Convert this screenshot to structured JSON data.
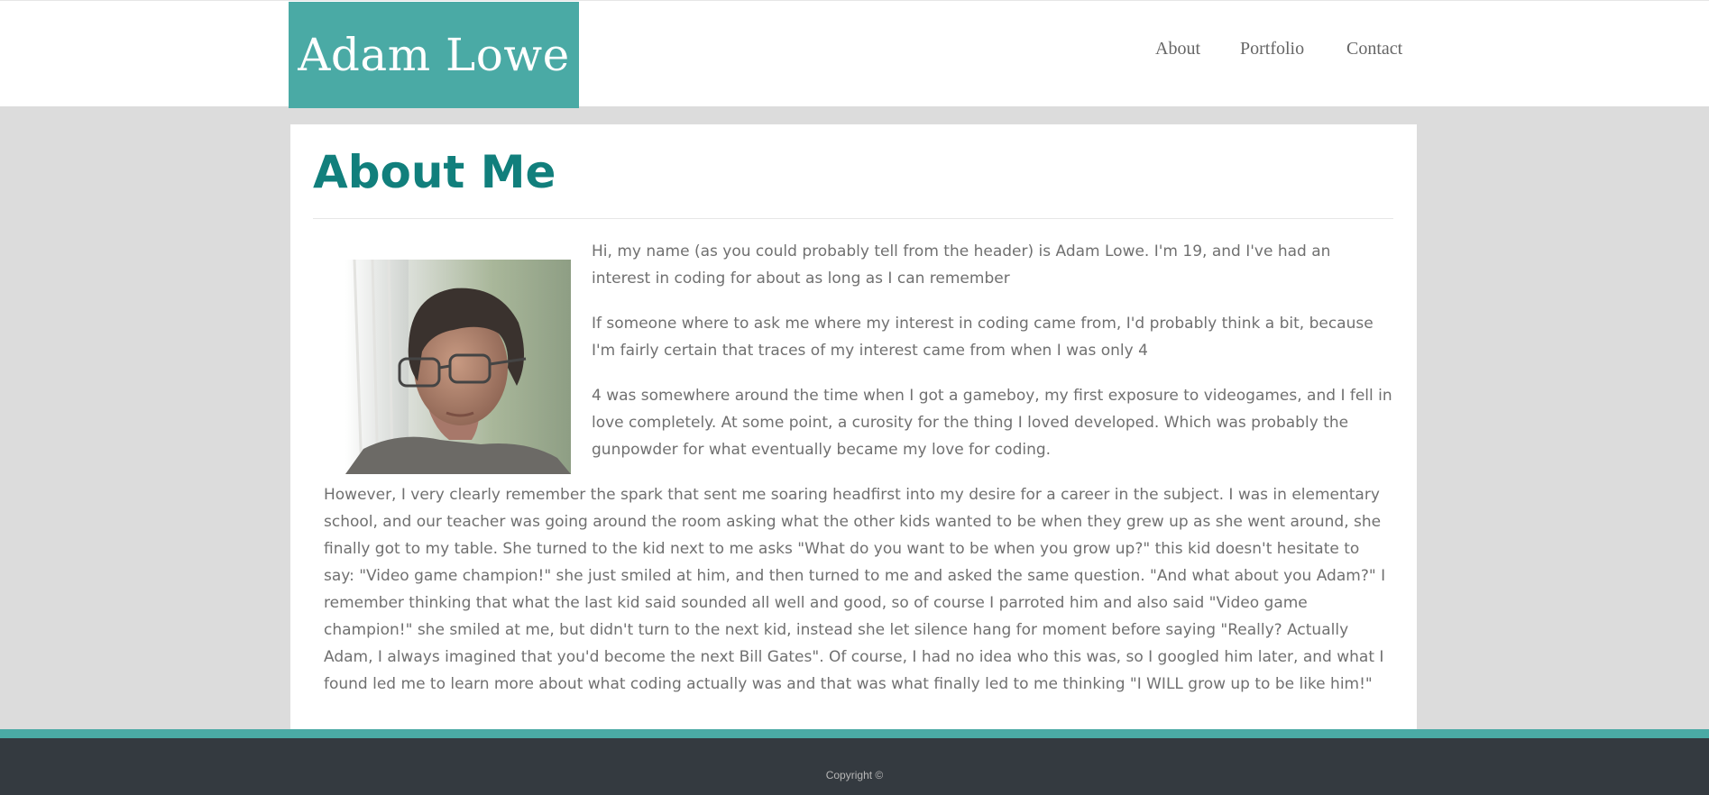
{
  "header": {
    "logo_text": "Adam Lowe",
    "nav": {
      "about": "About",
      "portfolio": "Portfolio",
      "contact": "Contact"
    }
  },
  "main": {
    "title": "About Me",
    "photo": "profile-photo",
    "paragraphs": [
      "Hi, my name (as you could probably tell from the header) is Adam Lowe. I'm 19, and I've had an interest in coding for about as long as I can remember",
      "If someone where to ask me where my interest in coding came from, I'd probably think a bit, because I'm fairly certain that traces of my interest came from when I was only 4",
      "4 was somewhere around the time when I got a gameboy, my first exposure to videogames, and I fell in love completely. At some point, a curosity for the thing I loved developed. Which was probably the gunpowder for what eventually became my love for coding.",
      "However, I very clearly remember the spark that sent me soaring headfirst into my desire for a career in the subject. I was in elementary school, and our teacher was going around the room asking what the other kids wanted to be when they grew up as she went around, she finally got to my table. She turned to the kid next to me asks \"What do you want to be when you grow up?\" this kid doesn't hesitate to say: \"Video game champion!\" she just smiled at him, and then turned to me and asked the same question. \"And what about you Adam?\" I remember thinking that what the last kid said sounded all well and good, so of course I parroted him and also said \"Video game champion!\" she smiled at me, but didn't turn to the next kid, instead she let silence hang for moment before saying \"Really? Actually Adam, I always imagined that you'd become the next Bill Gates\". Of course, I had no idea who this was, so I googled him later, and what I found led me to learn more about what coding actually was and that was what finally led to me thinking \"I WILL grow up to be like him!\""
    ]
  },
  "footer": {
    "copyright": "Copyright ©"
  },
  "colors": {
    "accent": "#4aaaa5",
    "title": "#117f7c",
    "footer": "#343a40",
    "background": "#dcdcdc"
  }
}
